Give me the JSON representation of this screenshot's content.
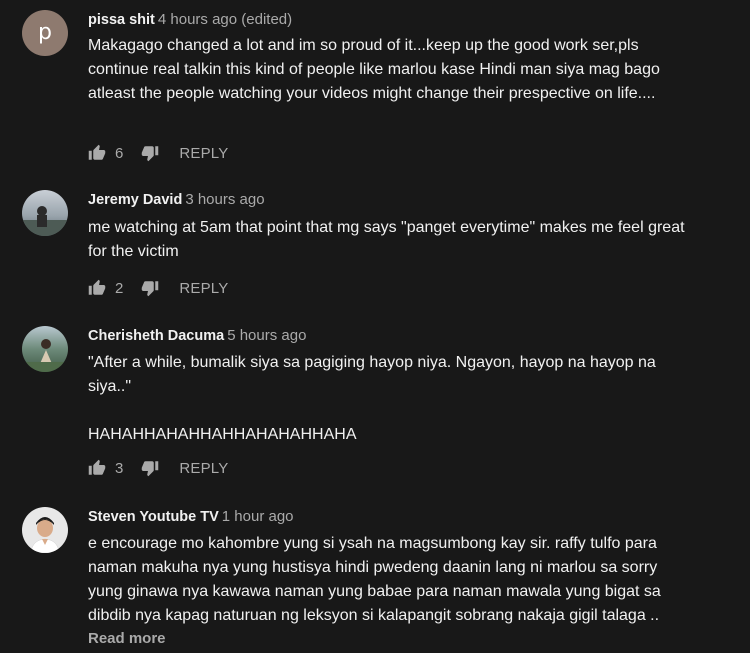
{
  "comments": [
    {
      "author": "pissa shit",
      "time": "4 hours ago (edited)",
      "avatar_letter": "p",
      "text": "Makagago changed a lot and im so proud of it...keep up the good work ser,pls continue real talkin this kind of people like marlou kase Hindi man siya mag bago atleast the people watching your videos  might change their prespective on life....",
      "likes": "6",
      "reply_label": "REPLY"
    },
    {
      "author": "Jeremy David",
      "time": "3 hours ago",
      "text": "me watching at 5am that point that mg says \"panget everytime\" makes me feel great for the victim",
      "likes": "2",
      "reply_label": "REPLY"
    },
    {
      "author": "Cherisheth Dacuma",
      "time": "5 hours ago",
      "text": "\"After a while, bumalik siya sa pagiging hayop niya. Ngayon, hayop na hayop na siya..\"\n\nHAHAHHAHAHHAHHAHAHAHHAHA",
      "likes": "3",
      "reply_label": "REPLY"
    },
    {
      "author": "Steven Youtube TV",
      "time": "1 hour ago",
      "text": "e encourage mo kahombre yung si ysah na magsumbong kay sir. raffy tulfo para naman makuha nya yung hustisya hindi pwedeng daanin lang ni marlou sa sorry yung ginawa nya kawawa naman yung babae para naman mawala yung bigat sa dibdib nya kapag naturuan ng leksyon si kalapangit sobrang nakaja gigil talaga ..",
      "read_more": "Read more"
    }
  ],
  "colors": {
    "background": "#181818",
    "text": "#f1f1f1",
    "secondary": "#aaaaaa",
    "avatar_letter_bg": "#8e7a6f"
  }
}
